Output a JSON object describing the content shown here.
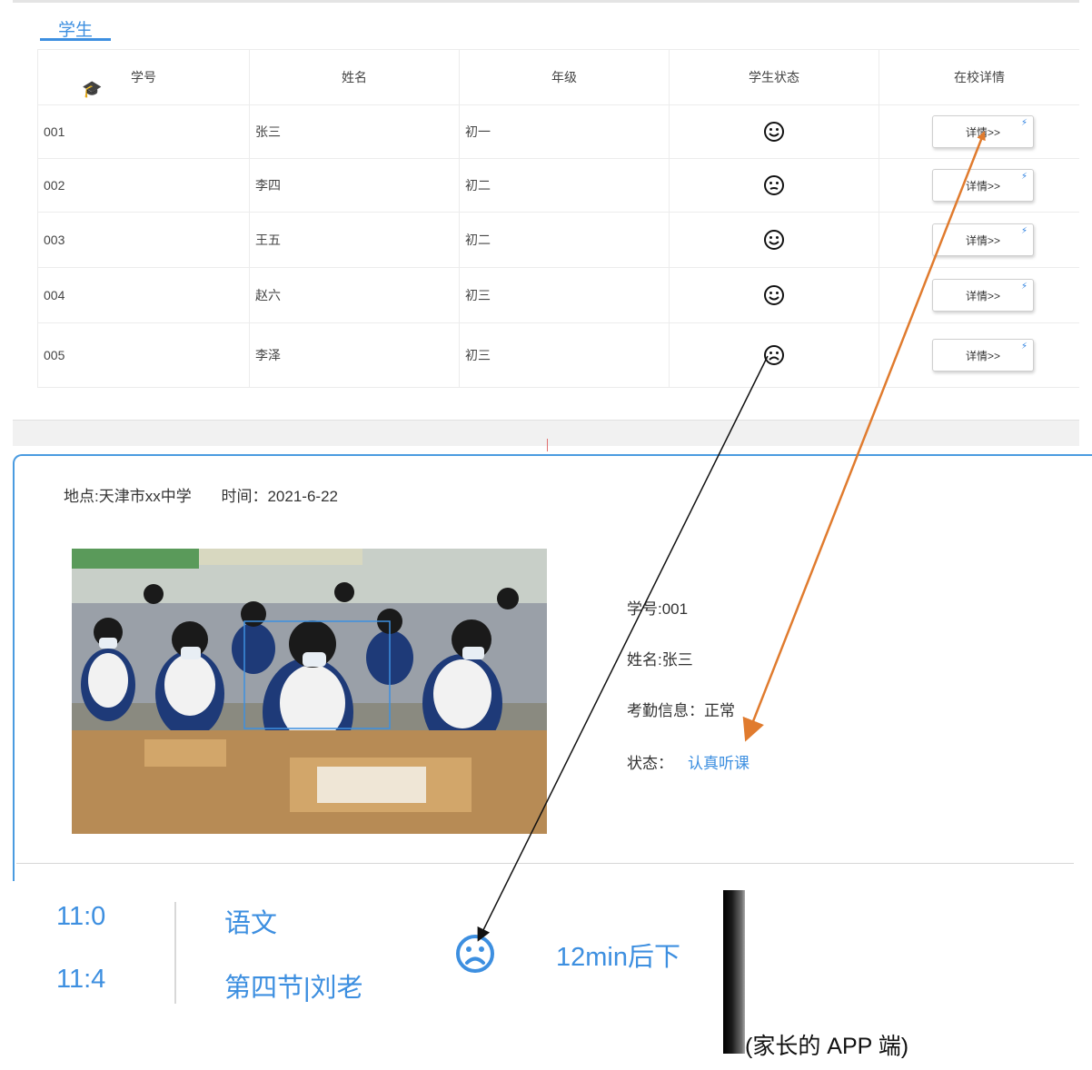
{
  "tab": {
    "label": "学生"
  },
  "table": {
    "headers": [
      "学号",
      "姓名",
      "年级",
      "学生状态",
      "在校详情"
    ],
    "rows": [
      {
        "id": "001",
        "name": "张三",
        "grade": "初一",
        "status": "happy",
        "action": "详情>>"
      },
      {
        "id": "002",
        "name": "李四",
        "grade": "初二",
        "status": "neutral",
        "action": "详情>>"
      },
      {
        "id": "003",
        "name": "王五",
        "grade": "初二",
        "status": "happy",
        "action": "详情>>"
      },
      {
        "id": "004",
        "name": "赵六",
        "grade": "初三",
        "status": "happy",
        "action": "详情>>"
      },
      {
        "id": "005",
        "name": "李泽",
        "grade": "初三",
        "status": "sad",
        "action": "详情>>"
      }
    ]
  },
  "detail": {
    "location": "地点:天津市xx中学",
    "time": "时间：2021-6-22",
    "student_id": "学号:001",
    "student_name": "姓名:张三",
    "attendance": "考勤信息：正常",
    "state_label": "状态：",
    "state_value": "认真听课"
  },
  "parent_app": {
    "time_start": "11:0",
    "time_end": "11:4",
    "subject": "语文",
    "lesson": "第四节|刘老",
    "countdown": "12min后下",
    "caption": "(家长的 APP 端)"
  },
  "colors": {
    "accent": "#3d8fe0",
    "arrow_orange": "#e07b2e",
    "arrow_black": "#111111"
  }
}
